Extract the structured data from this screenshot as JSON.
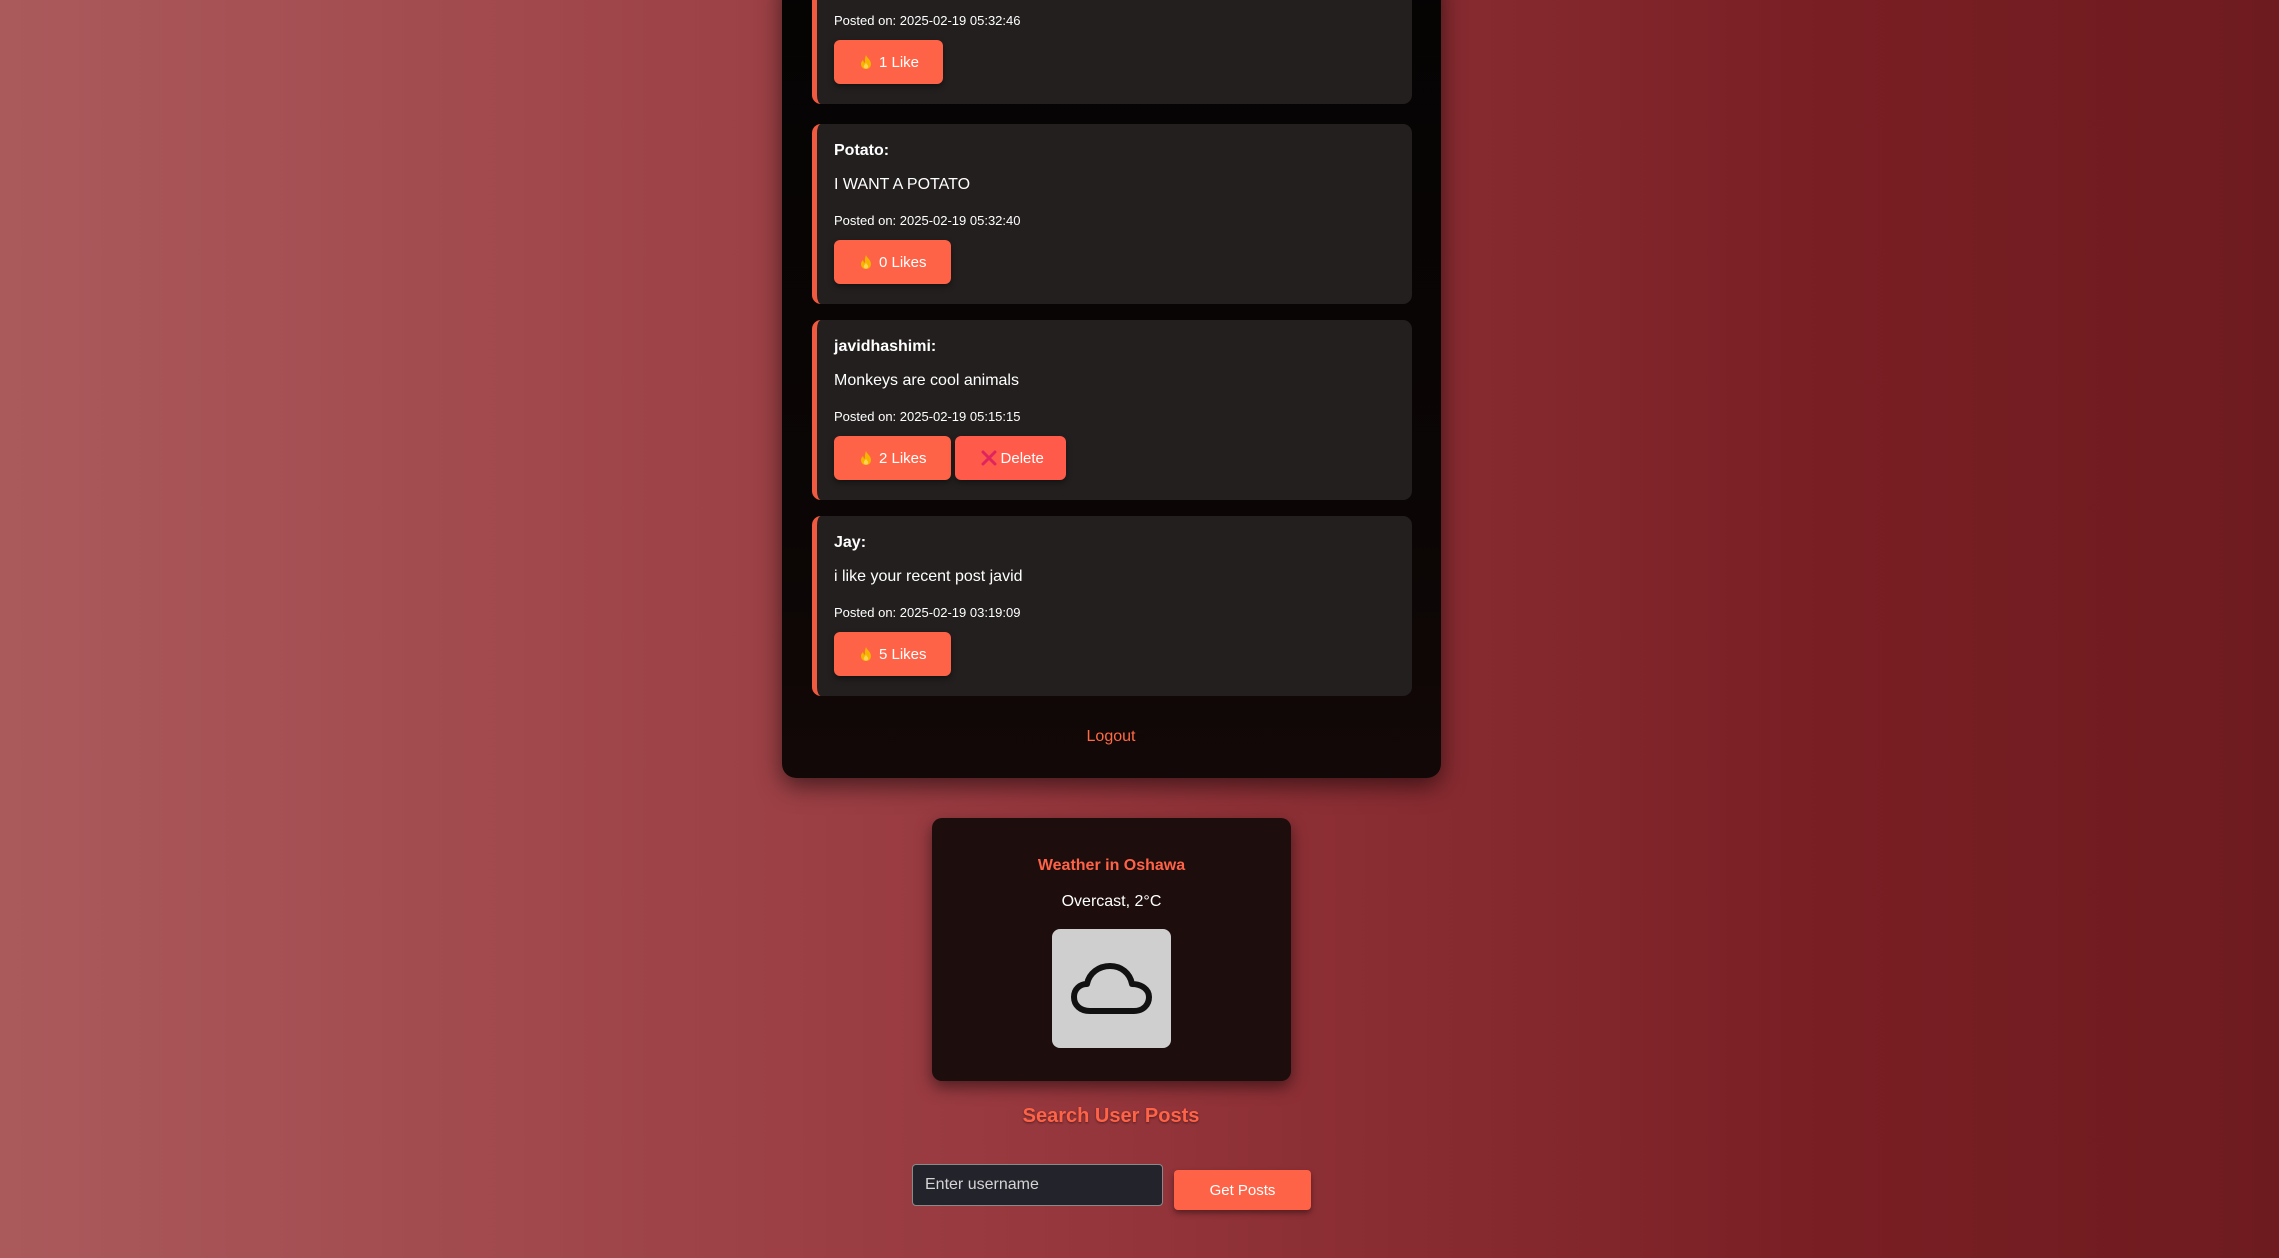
{
  "feed": {
    "posts": [
      {
        "author": "",
        "body": "",
        "posted": "Posted on: 2025-02-19 05:32:46",
        "like_label": "1 Like",
        "like_icon": "flame-icon"
      },
      {
        "author": "Potato:",
        "body": "I WANT A POTATO",
        "posted": "Posted on: 2025-02-19 05:32:40",
        "like_label": "0 Likes",
        "like_icon": "flame-icon"
      },
      {
        "author": "javidhashimi:",
        "body": "Monkeys are cool animals",
        "posted": "Posted on: 2025-02-19 05:15:15",
        "like_label": "2 Likes",
        "like_icon": "flame-icon",
        "delete_label": "Delete",
        "delete_icon": "cross-mark-icon"
      },
      {
        "author": "Jay:",
        "body": "i like your recent post javid",
        "posted": "Posted on: 2025-02-19 03:19:09",
        "like_label": "5 Likes",
        "like_icon": "flame-icon"
      }
    ],
    "logout_label": "Logout"
  },
  "weather": {
    "title": "Weather in Oshawa",
    "condition": "Overcast, 2°C",
    "icon": "cloud-icon"
  },
  "search": {
    "heading": "Search User Posts",
    "placeholder": "Enter username",
    "button_label": "Get Posts"
  },
  "colors": {
    "accent": "#ff6347",
    "panel": "#231f1f",
    "post_border": "#f05a40",
    "background_left": "#ab5a5c",
    "background_right": "#6e1b1f"
  }
}
